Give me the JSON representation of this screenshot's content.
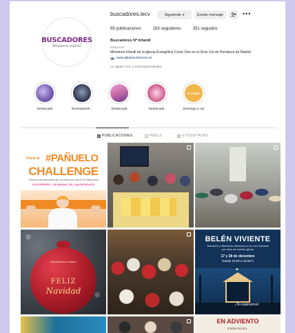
{
  "profile": {
    "username": "buscadores.iecv",
    "following_label": "Siguiendo",
    "message_label": "Enviar mensaje",
    "more_label": "•••",
    "stats": {
      "posts": "85 publicaciones",
      "followers": "183 seguidores",
      "following": "351 seguidos"
    },
    "name": "Buscadores Nº Infantil",
    "category": "Educación",
    "bio": "Ministerio Infantil de la Iglesia Evangélica Cristo Vive en la Gran Vía de Hortaleza de Madrid",
    "link": "www.iglesiacristovive.es",
    "followed_by": "Le siguen ic10_y rubenriquerasmitez",
    "avatar_logo": "BUSCADORES",
    "avatar_sub": "Ministerio Infantil"
  },
  "highlights": [
    {
      "label": "Destacada",
      "color": "#7a62b8"
    },
    {
      "label": "#instrayimeli...",
      "color": "#3a3f5a"
    },
    {
      "label": "Destacada",
      "color": "#c66aa8"
    },
    {
      "label": "Destacada",
      "color": "#d76a9a"
    },
    {
      "label": "Domingo 4 oct",
      "color": "#f2b64a"
    }
  ],
  "highlight_badge": "OCTUBRE",
  "tabs": [
    {
      "label": "PUBLICACIONES",
      "icon": "grid-icon"
    },
    {
      "label": "REELS",
      "icon": "reels-icon"
    },
    {
      "label": "ETIQUETADAS",
      "icon": "tagged-icon"
    }
  ],
  "posts": {
    "p1": {
      "top": "Únete al",
      "hashtag": "#PAÑUELO",
      "title": "CHALLENGE",
      "desc": "Tenemos que demostrar que los niños con cáncer no están solos",
      "date": "15 DE FEBRERO · DÍA MUNDIAL DEL CÁNCER INFANTIL"
    },
    "p4": {
      "small": "Buscadores le desea",
      "big1": "FELIZ",
      "big2": "Navidad"
    },
    "p6": {
      "title": "BELÉN VIVIENTE",
      "desc": "Narración y villancicos cantados por un coro formado por niños de nuestra iglesia",
      "dates": "17 y 28 de diciembre",
      "time": "Desde 19:00 a 20:00 h",
      "tagline": "¡Te esperamos!"
    },
    "p9": {
      "title": "EN ADVIENTO",
      "sub": "EMMANUEL"
    }
  },
  "colors": {
    "accent_purple": "#7a2b86",
    "pink": "#e0478f",
    "orange": "#f08a24",
    "navy": "#123258",
    "christmas_red": "#b01d2a"
  }
}
